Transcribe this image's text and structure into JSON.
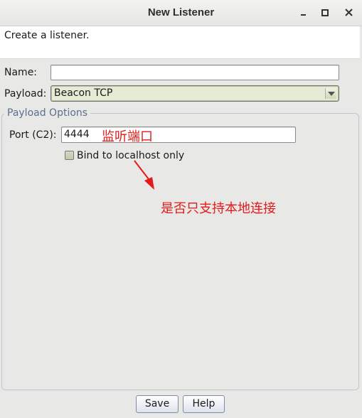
{
  "window": {
    "title": "New Listener"
  },
  "header": {
    "description": "Create a listener."
  },
  "form": {
    "name_label": "Name:",
    "name_value": "",
    "payload_label": "Payload:",
    "payload_value": "Beacon TCP"
  },
  "options": {
    "group_title": "Payload Options",
    "port_label": "Port (C2):",
    "port_value": "4444",
    "bind_label": "Bind to localhost only",
    "bind_checked": false
  },
  "annotations": {
    "port_note": "监听端口",
    "bind_note": "是否只支持本地连接",
    "color": "#e41a1a"
  },
  "buttons": {
    "save": "Save",
    "help": "Help"
  }
}
